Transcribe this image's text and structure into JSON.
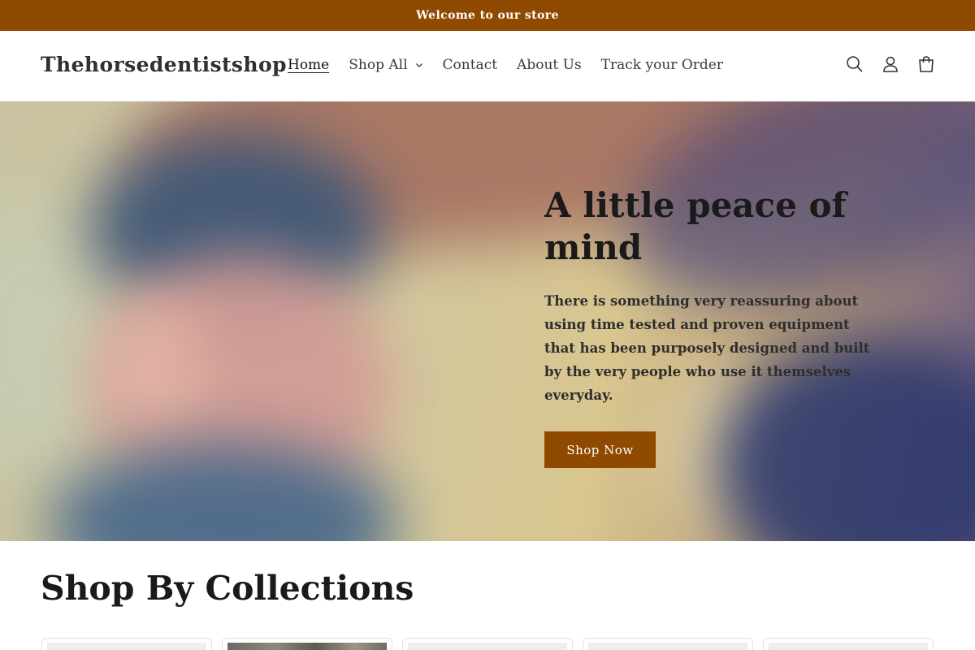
{
  "colors": {
    "brand": "#8f4a00",
    "button": "#8f4a00",
    "text": "#121212"
  },
  "announcement": {
    "text": "Welcome to our store"
  },
  "header": {
    "logo": "Thehorsedentistshop",
    "nav": [
      {
        "label": "Home",
        "active": true
      },
      {
        "label": "Shop All",
        "has_dropdown": true
      },
      {
        "label": "Contact"
      },
      {
        "label": "About Us"
      },
      {
        "label": "Track your Order"
      }
    ],
    "icons": [
      "search-icon",
      "account-icon",
      "cart-icon"
    ]
  },
  "hero": {
    "title": "A little peace of mind",
    "text": "There is something very reassuring about using time tested and proven equipment that has been purposely designed and built by the very people who use it themselves everyday.",
    "button_label": "Shop Now"
  },
  "collections": {
    "title": "Shop By Collections",
    "cards": [
      "collection-card",
      "collection-card",
      "collection-card",
      "collection-card",
      "collection-card"
    ]
  }
}
